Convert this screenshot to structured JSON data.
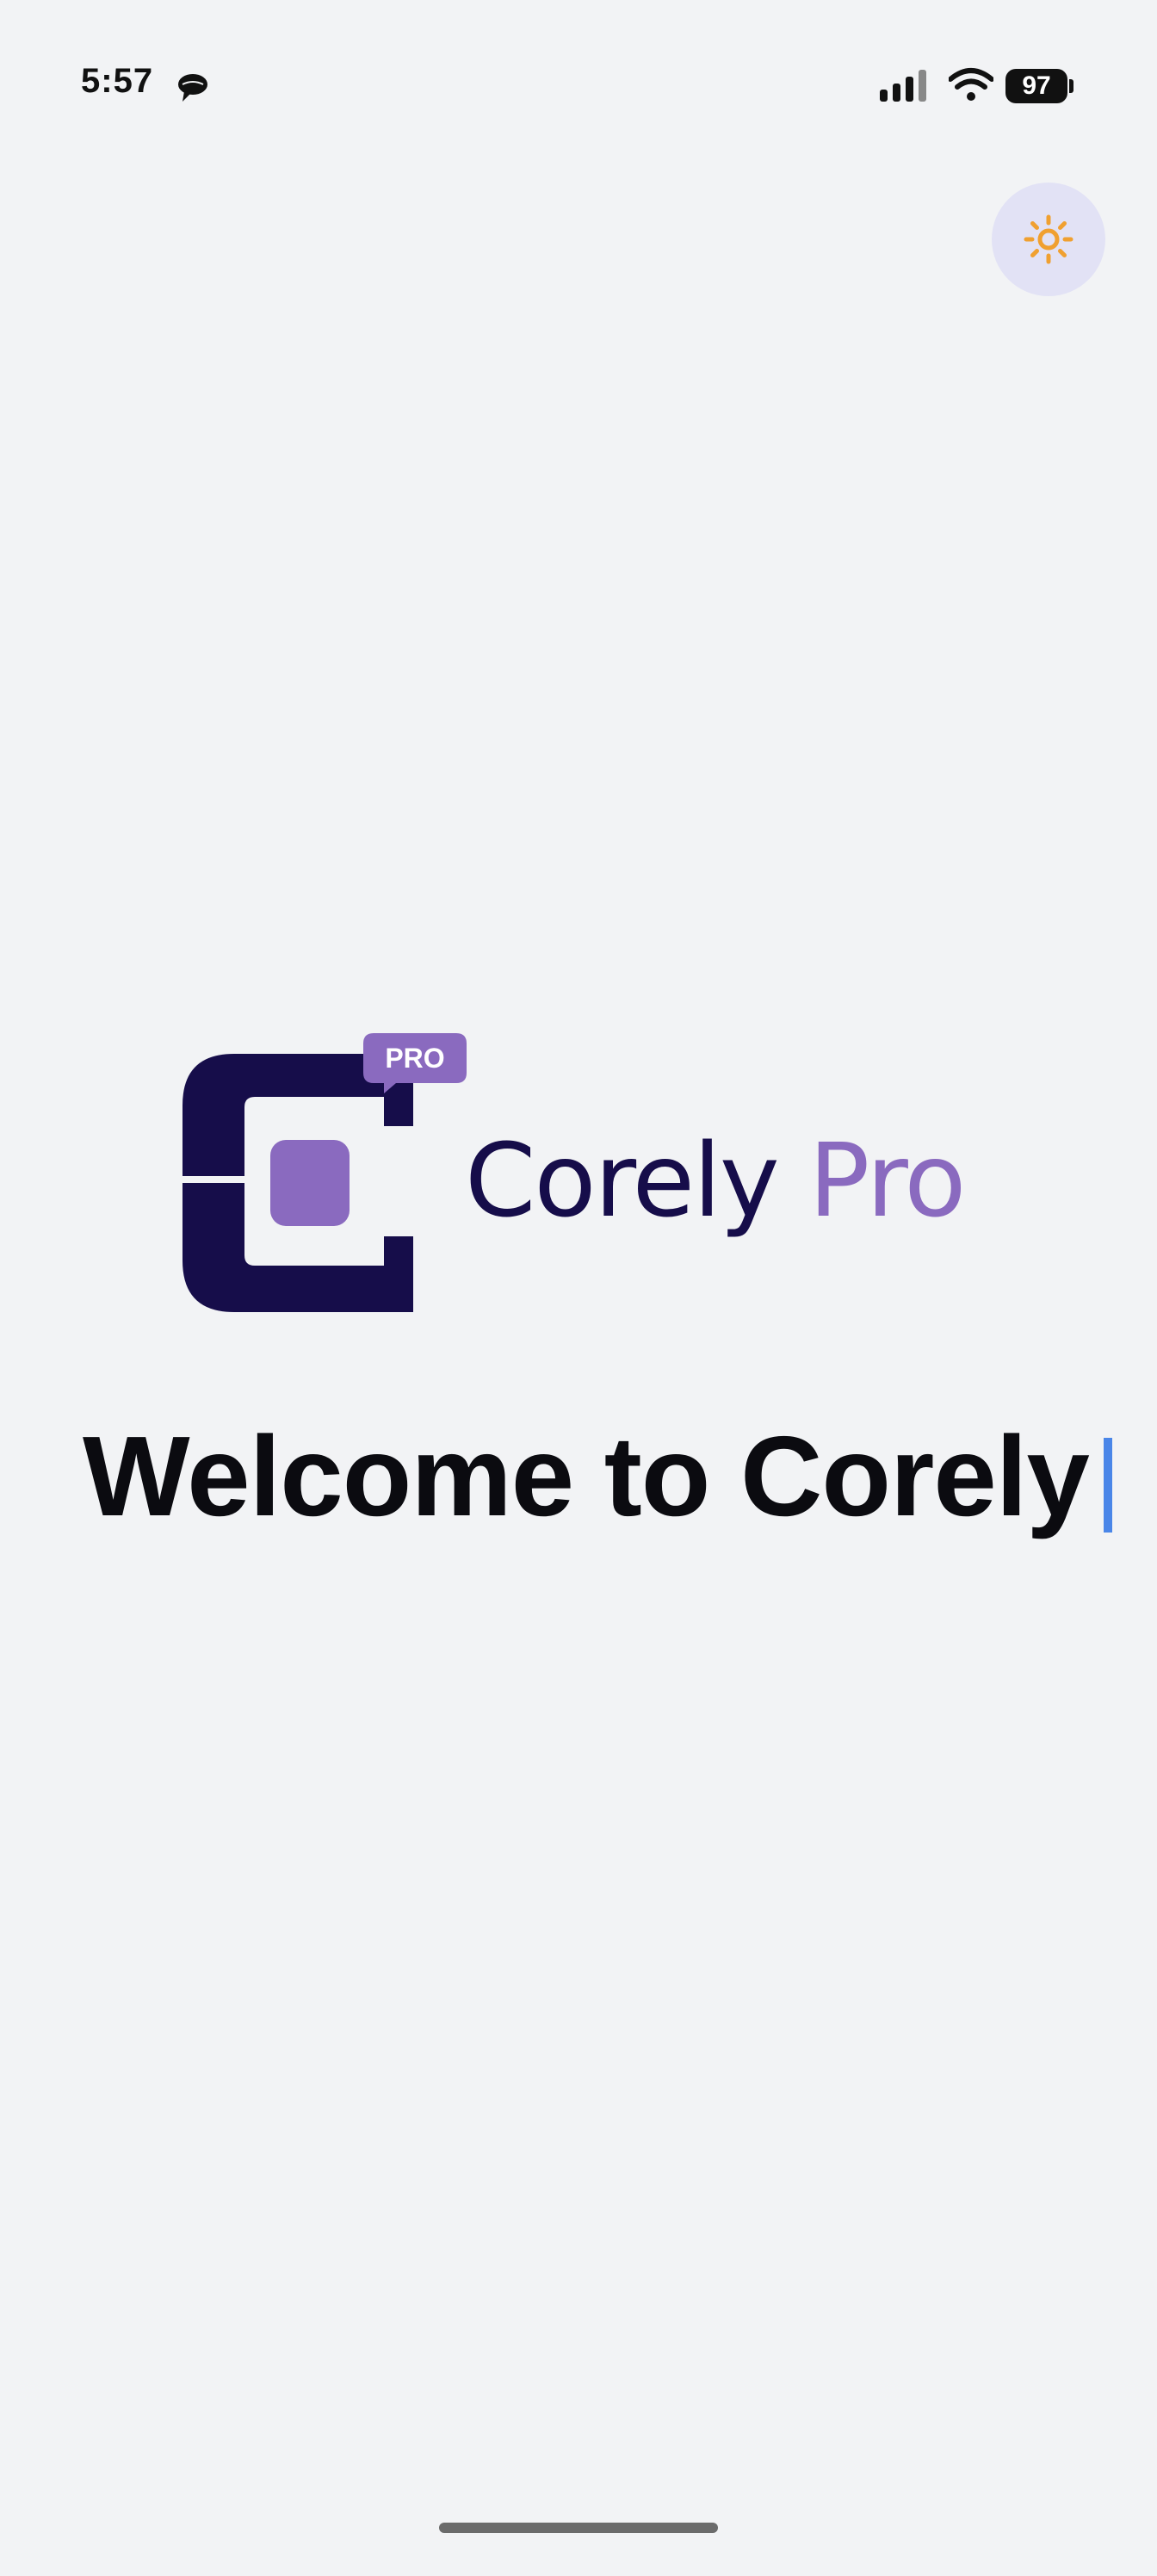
{
  "status_bar": {
    "time": "5:57",
    "battery": "97",
    "icons": [
      "message-bubble-icon",
      "cellular-signal-icon",
      "wifi-icon",
      "battery-icon"
    ]
  },
  "theme_toggle": {
    "icon": "sun-icon",
    "colors": {
      "background": "#e2e2f5",
      "icon": "#f0a030"
    }
  },
  "logo": {
    "badge": "PRO",
    "word_primary": "Corely",
    "word_secondary": "Pro",
    "colors": {
      "dark": "#160d4a",
      "accent": "#8a6abf"
    }
  },
  "welcome": {
    "title": "Welcome to Corely"
  },
  "colors": {
    "background": "#f2f3f5",
    "cursor": "#4a86e8"
  }
}
